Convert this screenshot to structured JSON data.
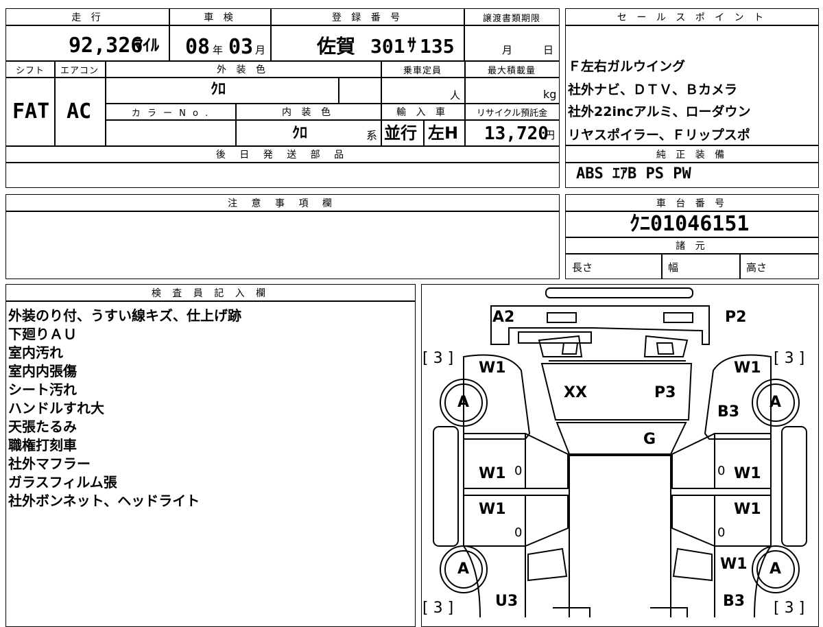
{
  "vehicle": {
    "mileage_header": "走 行",
    "mileage_value": "92,326",
    "mileage_unit": "ﾏｲﾙ",
    "inspection_header": "車 検",
    "inspection_year": "08",
    "inspection_year_unit": "年",
    "inspection_month": "03",
    "inspection_month_unit": "月",
    "registration_header": "登 録 番 号",
    "registration_region": "佐賀",
    "registration_class": "301",
    "registration_kana": "ｻ",
    "registration_number": "135",
    "transfer_deadline_header": "譲渡書類期限",
    "transfer_month_unit": "月",
    "transfer_day_unit": "日",
    "shift_header": "シフト",
    "shift_value": "FAT",
    "aircon_header": "エアコン",
    "aircon_value": "AC",
    "exterior_color_header": "外 装 色",
    "exterior_color_value": "ｸﾛ",
    "capacity_header": "乗車定員",
    "capacity_unit": "人",
    "max_load_header": "最大積載量",
    "max_load_unit": "kg",
    "color_no_header": "カ ラ ー N o .",
    "interior_color_header": "内 装 色",
    "interior_color_value": "ｸﾛ",
    "interior_color_suffix": "系",
    "import_header": "輸 入 車",
    "import_type": "並行",
    "handle_side": "左H",
    "recycle_header": "リサイクル預託金",
    "recycle_value": "13,720",
    "recycle_unit": "円",
    "later_parts_header": "後 日 発 送 部 品"
  },
  "sales_points": {
    "header": "セ ー ル ス ポ イ ン ト",
    "lines": [
      "Ｆ左右ガルウイング",
      "社外ナビ、ＤＴＶ、Ｂカメラ",
      "社外22incアルミ、ローダウン",
      "リヤスポイラー、Ｆリップスポ"
    ]
  },
  "standard_equipment": {
    "header": "純 正 装 備",
    "value": "ABS ｴｱB PS PW"
  },
  "notes": {
    "header": "注 意 事 項 欄"
  },
  "chassis": {
    "header": "車 台 番 号",
    "value": "ｸﾆ01046151",
    "specs_header": "諸 元",
    "length_label": "長さ",
    "width_label": "幅",
    "height_label": "高さ"
  },
  "inspector": {
    "header": "検 査 員 記 入 欄",
    "lines": [
      "外装のり付、うすい線キズ、仕上げ跡",
      "下廻りＡＵ",
      "室内汚れ",
      "室内内張傷",
      "シート汚れ",
      "ハンドルすれ大",
      "天張たるみ",
      "職権打刻車",
      "社外マフラー",
      "ガラスフィルム張",
      "社外ボンネット、ヘッドライト"
    ]
  },
  "diagram": {
    "labels": {
      "a2": "A2",
      "p2": "P2",
      "tl_count": "[ 3 ]",
      "tr_count": "[ 3 ]",
      "bl_count": "[ 3 ]",
      "br_count": "[ 3 ]",
      "w1_tl": "W1",
      "w1_tr": "W1",
      "xx": "XX",
      "p3": "P3",
      "b3_upper": "B3",
      "g": "G",
      "w1_ml": "W1",
      "w1_mr": "W1",
      "w1_ll": "W1",
      "w1_lr": "W1",
      "w1_br": "W1",
      "u3": "U3",
      "b3_lower": "B3",
      "zero_ml": "0",
      "zero_mr": "0",
      "zero_ll": "0",
      "zero_lr": "0",
      "wheel_tl": "A",
      "wheel_tr": "A",
      "wheel_bl": "A",
      "wheel_br": "A"
    }
  }
}
